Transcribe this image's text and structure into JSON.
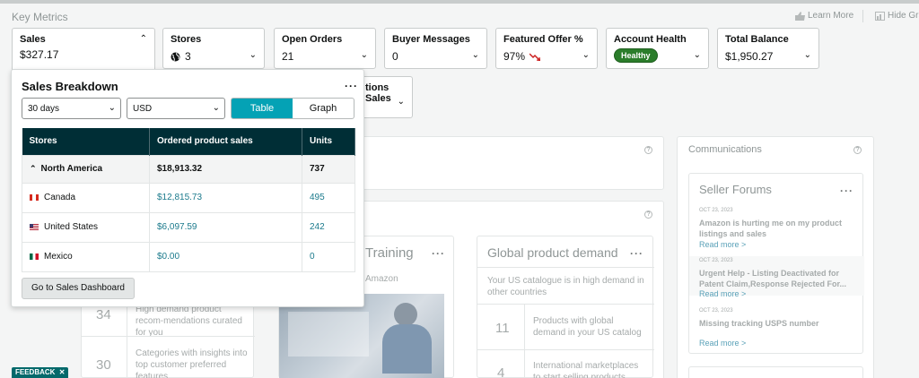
{
  "header": {
    "title": "Key Metrics",
    "learn_more": "Learn More",
    "hide_graph": "Hide Gra"
  },
  "metrics": [
    {
      "label": "Sales",
      "value": "$327.17"
    },
    {
      "label": "Stores",
      "value": "3"
    },
    {
      "label": "Open Orders",
      "value": "21"
    },
    {
      "label": "Buyer Messages",
      "value": "0"
    },
    {
      "label": "Featured Offer %",
      "value": "97%"
    },
    {
      "label": "Account Health",
      "badge": "Healthy"
    },
    {
      "label": "Total Balance",
      "value": "$1,950.27"
    }
  ],
  "hidden_card_label": "tions Sales",
  "popup": {
    "title": "Sales Breakdown",
    "period": "30 days",
    "currency": "USD",
    "toggle": [
      "Table",
      "Graph"
    ],
    "columns": [
      "Stores",
      "Ordered product sales",
      "Units"
    ],
    "region": {
      "name": "North America",
      "sales": "$18,913.32",
      "units": "737"
    },
    "rows": [
      {
        "store": "Canada",
        "sales": "$12,815.73",
        "units": "495"
      },
      {
        "store": "United States",
        "sales": "$6,097.59",
        "units": "242"
      },
      {
        "store": "Mexico",
        "sales": "$0.00",
        "units": "0"
      }
    ],
    "dashboard_button": "Go to Sales Dashboard"
  },
  "background": {
    "recommendations": [
      {
        "num": "34",
        "text": "High demand product recom-mendations curated for you"
      },
      {
        "num": "30",
        "text": "Categories with insights into top customer preferred features"
      }
    ],
    "training": {
      "title": "Training",
      "subtitle": "Amazon"
    },
    "global_demand": {
      "title": "Global product demand",
      "subtitle": "Your US catalogue is in high demand in other countries",
      "items": [
        {
          "num": "11",
          "text": "Products with global demand in your US catalog"
        },
        {
          "num": "4",
          "text": "International marketplaces to start selling products"
        }
      ]
    },
    "communications": {
      "title": "Communications",
      "forums_title": "Seller Forums",
      "posts": [
        {
          "date": "OCT 23, 2023",
          "title": "Amazon is hurting me on my product listings and sales",
          "link": "Read more >"
        },
        {
          "date": "OCT 23, 2023",
          "title": "Urgent Help - Listing Deactivated for Patent Claim,Response Rejected For...",
          "link": "Read more >"
        },
        {
          "date": "OCT 23, 2023",
          "title": "Missing tracking USPS number",
          "link": "Read more >"
        }
      ]
    }
  },
  "feedback": "FEEDBACK"
}
